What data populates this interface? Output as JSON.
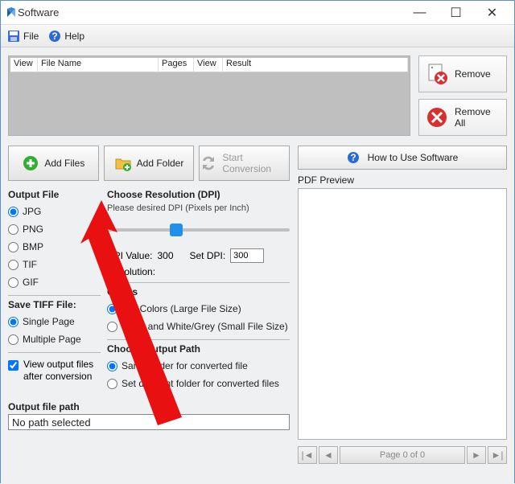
{
  "window": {
    "title": "Software"
  },
  "menu": {
    "file": "File",
    "help": "Help"
  },
  "filelist": {
    "cols": {
      "view1": "View",
      "filename": "File Name",
      "pages": "Pages",
      "view2": "View",
      "result": "Result"
    }
  },
  "buttons": {
    "remove": "Remove",
    "removeAll": "Remove All",
    "addFiles": "Add Files",
    "addFolder": "Add Folder",
    "startConversion": "Start Conversion",
    "howto": "How to Use Software"
  },
  "output": {
    "title": "Output File",
    "jpg": "JPG",
    "png": "PNG",
    "bmp": "BMP",
    "tif": "TIF",
    "gif": "GIF"
  },
  "resolution": {
    "title": "Choose Resolution (DPI)",
    "hint": "Please desired DPI (Pixels per Inch)",
    "dpiValueLbl": "DPI Value:",
    "dpiValue": "300",
    "setDpiLbl": "Set DPI:",
    "setDpiValue": "300",
    "resolutionLbl": "Resolution:"
  },
  "tiff": {
    "title": "Save TIFF File:",
    "single": "Single Page",
    "multi": "Multiple Page"
  },
  "colors": {
    "title": "Colors",
    "full": "Full Colors (Large File Size)",
    "bw": "Black and White/Grey (Small File Size)"
  },
  "outpath": {
    "title": "Choose Output Path",
    "same": "Same folder for converted file",
    "diff": "Set different folder for converted files",
    "viewAfter": "View output files after conversion",
    "lbl": "Output file path",
    "value": "No path selected"
  },
  "preview": {
    "label": "PDF Preview",
    "pager": "Page 0 of 0"
  }
}
